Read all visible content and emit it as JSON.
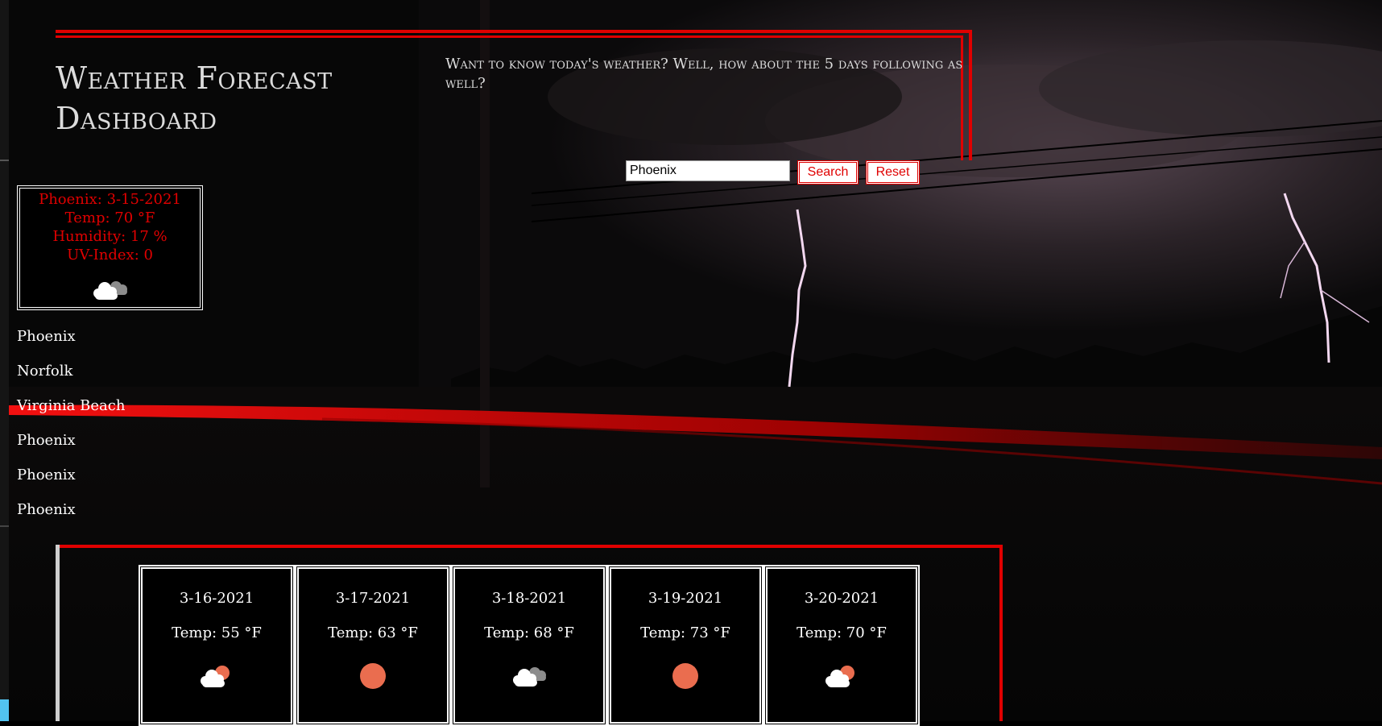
{
  "header": {
    "title": "Weather Forecast Dashboard",
    "tagline": "Want to know today's weather? Well, how about the 5 days following as well?"
  },
  "search": {
    "value": "Phoenix",
    "search_label": "Search",
    "reset_label": "Reset"
  },
  "current": {
    "heading": "Phoenix: 3-15-2021",
    "temp": "Temp: 70 °F",
    "humidity": "Humidity: 17 %",
    "uv": "UV-Index: 0",
    "icon": "clouds-icon"
  },
  "history": [
    "Phoenix",
    "Norfolk",
    "Virginia Beach",
    "Phoenix",
    "Phoenix",
    "Phoenix"
  ],
  "forecast": [
    {
      "date": "3-16-2021",
      "temp": "Temp: 55 °F",
      "icon": "partly-cloudy-icon"
    },
    {
      "date": "3-17-2021",
      "temp": "Temp: 63 °F",
      "icon": "sun-icon"
    },
    {
      "date": "3-18-2021",
      "temp": "Temp: 68 °F",
      "icon": "clouds-icon"
    },
    {
      "date": "3-19-2021",
      "temp": "Temp: 73 °F",
      "icon": "sun-icon"
    },
    {
      "date": "3-20-2021",
      "temp": "Temp: 70 °F",
      "icon": "partly-cloudy-icon"
    }
  ],
  "colors": {
    "accent": "#e00000",
    "sun": "#ea6d4f"
  }
}
